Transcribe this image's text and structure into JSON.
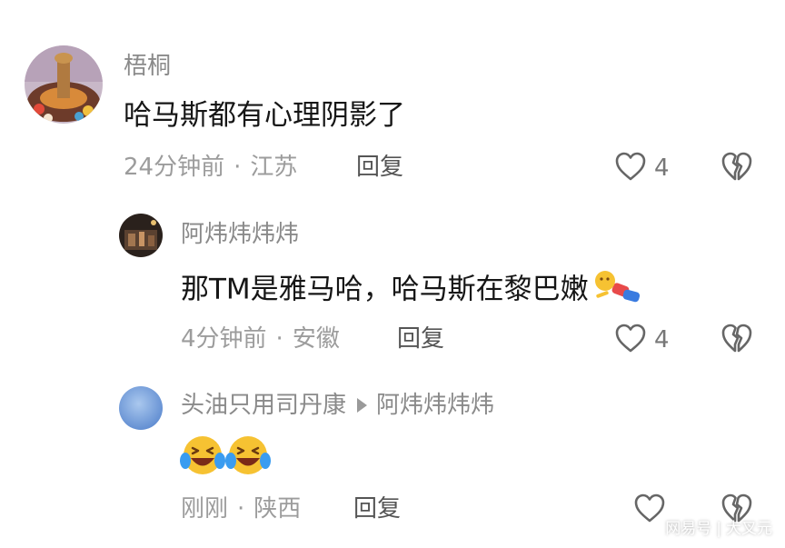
{
  "comments": [
    {
      "username": "梧桐",
      "text": "哈马斯都有心理阴影了",
      "time": "24分钟前",
      "location": "江苏",
      "reply_label": "回复",
      "likes": "4"
    },
    {
      "username": "阿炜炜炜炜",
      "text": "那TM是雅马哈，哈马斯在黎巴嫩",
      "time": "4分钟前",
      "location": "安徽",
      "reply_label": "回复",
      "likes": "4"
    },
    {
      "username": "头油只用司丹康",
      "reply_to": "阿炜炜炜炜",
      "text": "",
      "time": "刚刚",
      "location": "陕西",
      "reply_label": "回复",
      "likes": ""
    }
  ],
  "watermark": {
    "source": "网易号",
    "separator": "|",
    "author": "大叉元"
  },
  "colors": {
    "username": "#8a8a8a",
    "text": "#161616",
    "meta": "#9c9c9c",
    "icon": "#666666"
  },
  "icons": [
    "heart-icon",
    "broken-heart-icon",
    "laughing-crying-emoji",
    "fallen-figure-emoji"
  ]
}
